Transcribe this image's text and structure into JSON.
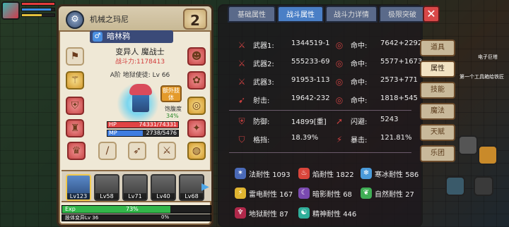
{
  "hud": {
    "mp_label": "MP",
    "hp_label": "HP"
  },
  "character": {
    "title": "机械之玛尼",
    "rank": "2",
    "gender_icon": "male-icon",
    "name": "暗林鸦",
    "class": "变异人 魔战士",
    "power": "战斗力:1178413",
    "level": "A阶 地狱使徒: Lv 66",
    "extra_badge": "额外肢体",
    "satiety_label": "饱腹度",
    "satiety_value": "34%",
    "hp_label": "HP",
    "hp_value": "74331/74331",
    "mp_label": "MP",
    "mp_value": "2738/5476"
  },
  "team": [
    {
      "level": "Lv123",
      "selected": true
    },
    {
      "level": "Lv58",
      "selected": false
    },
    {
      "level": "Lv71",
      "selected": false
    },
    {
      "level": "Lv40",
      "selected": false
    },
    {
      "level": "Lv68",
      "selected": false
    }
  ],
  "exp": {
    "label": "Exp",
    "value": "73%",
    "percent": 73
  },
  "sub": {
    "label": "肢体变异Lv 36",
    "value": "0%"
  },
  "tabs": [
    {
      "label": "基础属性",
      "active": false
    },
    {
      "label": "战斗属性",
      "active": true
    },
    {
      "label": "战斗力详情",
      "active": false
    },
    {
      "label": "极限突破",
      "active": false
    }
  ],
  "close_label": "✕",
  "combat_stats": [
    {
      "label": "武器1:",
      "value": "1344519-1",
      "hit_label": "命中:",
      "hit_value": "7642+2292"
    },
    {
      "label": "武器2:",
      "value": "555233-69",
      "hit_label": "命中:",
      "hit_value": "5577+1673"
    },
    {
      "label": "武器3:",
      "value": "91953-113",
      "hit_label": "命中:",
      "hit_value": "2573+771"
    },
    {
      "label": "射击:",
      "value": "19642-232",
      "hit_label": "命中:",
      "hit_value": "1818+545"
    }
  ],
  "defense": {
    "defense_label": "防御:",
    "defense_value": "14899[重]",
    "dodge_label": "闪避:",
    "dodge_value": "5243",
    "block_label": "格挡:",
    "block_value": "18.39%",
    "crit_label": "暴击:",
    "crit_value": "121.81%"
  },
  "resistances": [
    {
      "label": "法耐性",
      "value": "1093",
      "color": "#4a6ab8",
      "icon": "magic-resist-icon"
    },
    {
      "label": "焰耐性",
      "value": "1822",
      "color": "#d9453b",
      "icon": "fire-resist-icon"
    },
    {
      "label": "寒冰耐性",
      "value": "586",
      "color": "#4a9ad9",
      "icon": "ice-resist-icon"
    },
    {
      "label": "雷电耐性",
      "value": "167",
      "color": "#e0b430",
      "icon": "thunder-resist-icon"
    },
    {
      "label": "暗影耐性",
      "value": "68",
      "color": "#7a4ab0",
      "icon": "shadow-resist-icon"
    },
    {
      "label": "自然耐性",
      "value": "27",
      "color": "#3fae55",
      "icon": "nature-resist-icon"
    },
    {
      "label": "地狱耐性",
      "value": "87",
      "color": "#b0284a",
      "icon": "hell-resist-icon"
    },
    {
      "label": "精神耐性",
      "value": "446",
      "color": "#2fae9a",
      "icon": "spirit-resist-icon"
    }
  ],
  "side_menu": [
    {
      "label": "道具",
      "active": false
    },
    {
      "label": "属性",
      "active": true
    },
    {
      "label": "技能",
      "active": false
    },
    {
      "label": "魔法",
      "active": false
    },
    {
      "label": "天赋",
      "active": false
    },
    {
      "label": "乐团",
      "active": false
    }
  ],
  "map_labels": {
    "electric_tower": "电子巨塔",
    "hint": "第一个工具箱给铁匠"
  }
}
